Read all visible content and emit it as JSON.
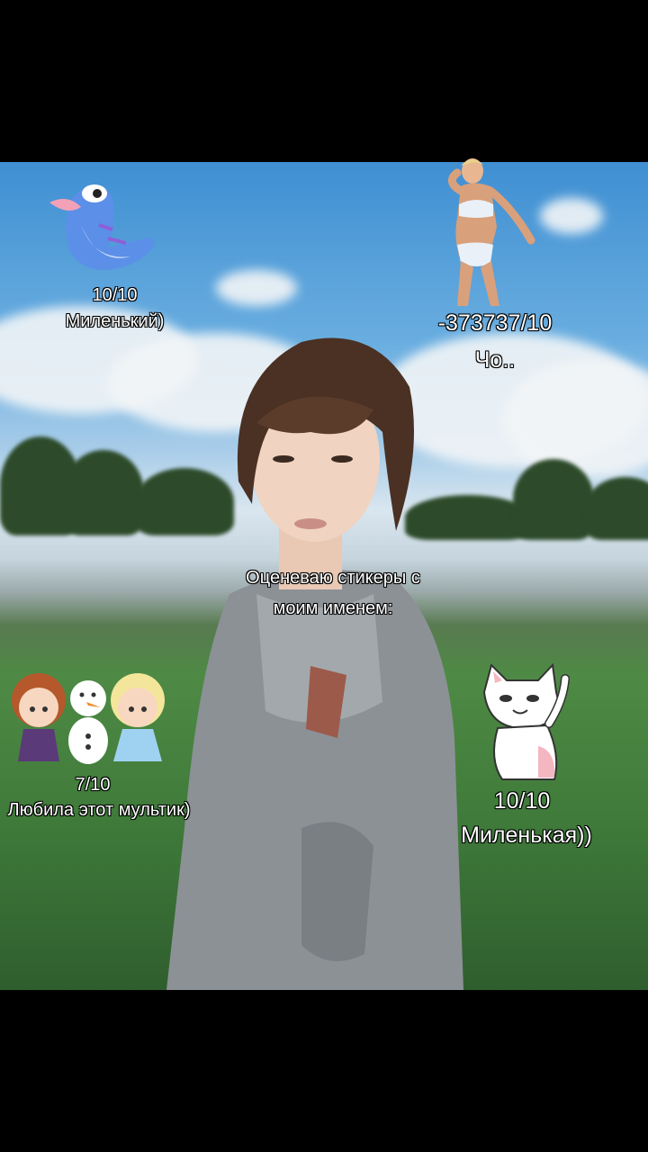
{
  "title": {
    "line1": "Оценеваю стикеры с",
    "line2": "моим именем:"
  },
  "stickers": [
    {
      "name": "shark-lizard",
      "rating": "10/10",
      "comment": "Миленький)"
    },
    {
      "name": "woman-swimsuit",
      "rating": "-373737/10",
      "comment": "Чо.."
    },
    {
      "name": "frozen-characters",
      "rating": "7/10",
      "comment": "Любила этот мультик)"
    },
    {
      "name": "cat",
      "rating": "10/10",
      "comment": "Миленькая))"
    }
  ]
}
